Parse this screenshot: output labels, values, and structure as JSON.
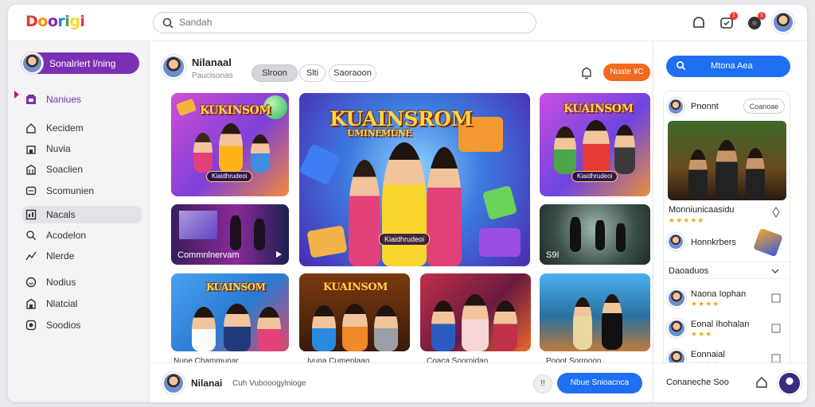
{
  "app": {
    "logo": [
      "D",
      "o",
      "o",
      "r",
      "i",
      "g",
      "i"
    ],
    "search": {
      "placeholder": "Sandah"
    }
  },
  "sidebar": {
    "profile_label": "Sonalrlert l/ning",
    "items": [
      {
        "label": "Naniues",
        "icon": "library-icon"
      },
      {
        "label": "Kecidem",
        "icon": "home-icon"
      },
      {
        "label": "Nuvia",
        "icon": "store-icon"
      },
      {
        "label": "Soaclien",
        "icon": "building-icon"
      },
      {
        "label": "Scomunien",
        "icon": "message-icon"
      },
      {
        "label": "Nacals",
        "icon": "grid-icon"
      },
      {
        "label": "Acodelon",
        "icon": "search-icon"
      },
      {
        "label": "Nlerde",
        "icon": "chart-icon"
      },
      {
        "label": "Nodius",
        "icon": "smile-icon"
      },
      {
        "label": "Nlatcial",
        "icon": "shop-icon"
      },
      {
        "label": "Soodios",
        "icon": "settings-icon"
      }
    ]
  },
  "main": {
    "channel_name": "Nilanaal",
    "channel_sub": "Paucisonas",
    "chips": [
      "Slroon",
      "Slti",
      "Saoraoon"
    ],
    "orange_button": "Nuate ¥C",
    "tiles": {
      "top_left_title": "KUKINSOM",
      "top_left_badge": "Kiaidhrudeoi",
      "center_title": "KUAINSROM",
      "center_sub": "UMINEMUNE",
      "center_badge": "Kiaidhrudeoi",
      "top_right_title": "KUAINSOM",
      "top_right_badge": "Kiaidhrudeoi",
      "mid_left_caption": "Commnlnervam",
      "mid_right_caption": "S9I",
      "bottom1_title": "KUAINSOM",
      "bottom2_title": "KUAINSOM"
    },
    "below_captions": [
      "Nune Chammunar",
      "Ivuna Cumenlaan",
      "Coaca Soornidan",
      "Pooot Sormoon"
    ],
    "bottom_bar": {
      "name": "Nilanai",
      "sub": "Cuh  Vubooogylnioge",
      "small_btn": "!!",
      "button": "Nbue Snioacnca"
    }
  },
  "right_panel": {
    "button": "Mtona Aea",
    "card_header": "Pnonnt",
    "card_header_chip": "Coanoae",
    "feature_name": "Monniunicaasidu",
    "feature_stars": "★★★★★",
    "row2_name": "Honnkrbers",
    "section_label": "Daoaduos",
    "list": [
      {
        "name": "Naona Iophan",
        "stars": "★★★★"
      },
      {
        "name": "Eonal Ihohalan",
        "stars": "★★★"
      },
      {
        "name": "Eonnaial",
        "stars": "★★★★"
      }
    ],
    "footer": "Conaneche Soo"
  },
  "colors": {
    "accent_purple": "#7b2fb2",
    "accent_blue": "#1e6ff2",
    "accent_orange": "#f26a1b"
  }
}
